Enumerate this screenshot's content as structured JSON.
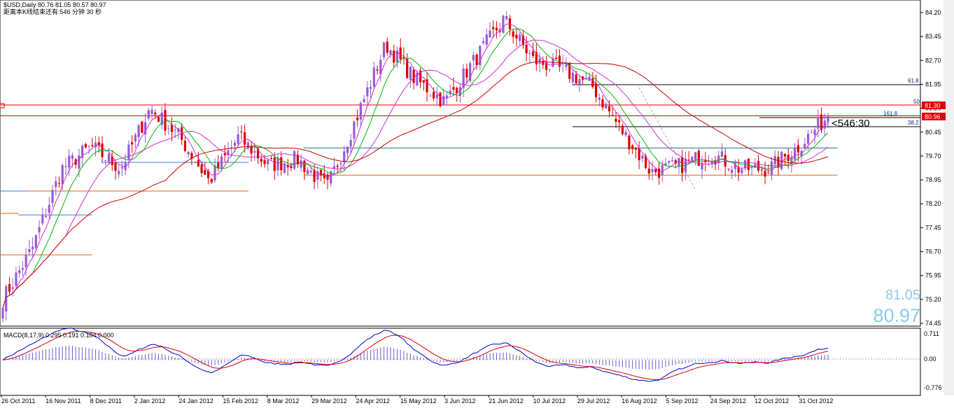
{
  "header": {
    "symbol_line": "$USD,Daily  80.76 81.05 80.57 80.97",
    "countdown_line": "距离本K线结束还有:546 分钟 30 秒"
  },
  "big_quote": {
    "high": "81.05",
    "close": "80.97"
  },
  "countdown_label": "<546:30",
  "macd": {
    "label": "MACD(8,17,9) 0.295 0.191 0.104 0.000",
    "axis": [
      "0.711",
      "0.00",
      "-0.776"
    ],
    "ylim": [
      -0.9,
      0.78
    ]
  },
  "colors": {
    "bull": "#9b59d6",
    "bear": "#dd0000",
    "ma_green": "#00bb00",
    "ma_magenta": "#cc33cc",
    "ma_red": "#cc0000",
    "hline_red": "#dd0000",
    "hline_orange": "#e06010",
    "hline_teal": "#1e7b8c",
    "hline_blue": "#3a7bd5",
    "fib": "#000000",
    "macd_line": "#0000cc",
    "signal_line": "#dd0000",
    "hist": "#6a5acd"
  },
  "chart_data": {
    "type": "candlestick",
    "title": "$USD,Daily",
    "ohlc_last": {
      "open": 80.76,
      "high": 81.05,
      "low": 80.57,
      "close": 80.97
    },
    "y_ticks": [
      "84.20",
      "83.45",
      "82.70",
      "81.95",
      "81.20",
      "80.45",
      "79.70",
      "78.95",
      "78.20",
      "77.45",
      "76.70",
      "75.95",
      "75.20",
      "74.45"
    ],
    "ylim": [
      74.45,
      84.2
    ],
    "x_ticks": [
      "26 Oct 2011",
      "16 Nov 2011",
      "8 Dec 2011",
      "2 Jan 2012",
      "24 Jan 2012",
      "15 Feb 2012",
      "8 Mar 2012",
      "29 Mar 2012",
      "24 Apr 2012",
      "15 May 2012",
      "3 Jun 2012",
      "21 Jun 2012",
      "10 Jul 2012",
      "29 Jul 2012",
      "16 Aug 2012",
      "5 Sep 2012",
      "24 Sep 2012",
      "12 Oct 2012",
      "31 Oct 2012"
    ],
    "anchors": [
      75.2,
      76.8,
      79.3,
      80.0,
      79.3,
      81.2,
      80.3,
      78.9,
      80.3,
      79.4,
      79.6,
      78.7,
      80.9,
      83.2,
      82.1,
      81.4,
      82.7,
      84.0,
      82.7,
      82.4,
      81.9,
      80.5,
      79.2,
      79.4,
      79.8,
      79.3,
      79.3,
      80.0,
      80.97
    ],
    "price_labels": [
      {
        "label": "81.30",
        "value": 81.3,
        "color": "#dd0000"
      },
      {
        "label": "80.96",
        "value": 80.96,
        "color": "#dd0000"
      }
    ],
    "fib_levels": [
      {
        "label": "61.8",
        "value": 81.95
      },
      {
        "label": "50",
        "value": 81.32
      },
      {
        "label": "38.2",
        "value": 80.6
      },
      {
        "label": "161.8",
        "value": 80.9
      }
    ],
    "h_lines": [
      {
        "value": 81.3,
        "color": "#dd0000",
        "from": 0,
        "to": 1
      },
      {
        "value": 80.96,
        "color": "#dd0000",
        "from": 0,
        "to": 1
      },
      {
        "value": 79.95,
        "color": "#1e7b8c",
        "from": 0.33,
        "to": 0.91
      },
      {
        "value": 79.1,
        "color": "#e06010",
        "from": 0.33,
        "to": 0.91
      },
      {
        "value": 79.5,
        "color": "#3a7bd5",
        "from": 0.11,
        "to": 0.27
      },
      {
        "value": 78.6,
        "color": "#e06010",
        "from": 0.0,
        "to": 0.27
      },
      {
        "value": 77.85,
        "color": "#3a7bd5",
        "from": 0.02,
        "to": 0.1
      },
      {
        "value": 77.9,
        "color": "#e06010",
        "from": 0.0,
        "to": 0.02
      },
      {
        "value": 76.6,
        "color": "#e06010",
        "from": 0.0,
        "to": 0.1
      },
      {
        "value": 78.6,
        "color": "#3a7bd5",
        "from": 0.0,
        "to": 0.03
      }
    ]
  }
}
